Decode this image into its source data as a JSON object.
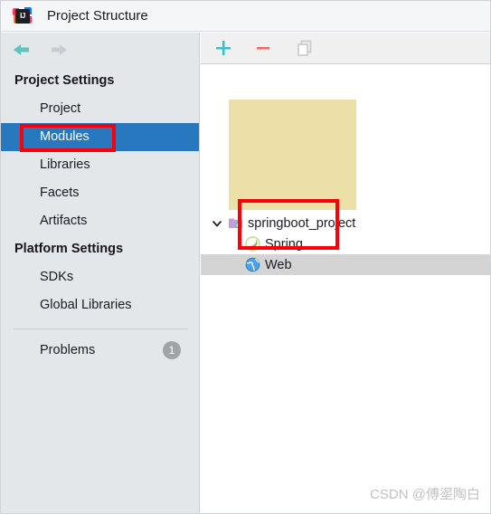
{
  "window": {
    "title": "Project Structure",
    "app_icon": "intellij-idea-icon",
    "icon_text": "IJ"
  },
  "nav": {
    "back_icon": "arrow-left-icon",
    "forward_icon": "arrow-right-icon",
    "back_enabled_color": "#5fc3c0",
    "forward_disabled_color": "#c8cdd1"
  },
  "sidebar": {
    "groups": [
      {
        "title": "Project Settings",
        "items": [
          {
            "label": "Project",
            "selected": false
          },
          {
            "label": "Modules",
            "selected": true
          },
          {
            "label": "Libraries",
            "selected": false
          },
          {
            "label": "Facets",
            "selected": false
          },
          {
            "label": "Artifacts",
            "selected": false
          }
        ]
      },
      {
        "title": "Platform Settings",
        "items": [
          {
            "label": "SDKs",
            "selected": false
          },
          {
            "label": "Global Libraries",
            "selected": false
          }
        ]
      }
    ],
    "problems": {
      "label": "Problems",
      "count": "1"
    },
    "selection_color": "#2878c0"
  },
  "toolbar": {
    "add_label": "+",
    "add_icon": "plus-icon",
    "add_color": "#3ec0c9",
    "remove_label": "−",
    "remove_icon": "minus-icon",
    "remove_color": "#ec6b64",
    "copy_icon": "copy-icon",
    "copy_color": "#c6c6c6"
  },
  "tree": {
    "rows": [
      {
        "label": "springboot_project",
        "icon": "module-folder-icon",
        "expanded": true,
        "selected": false,
        "depth": 0
      },
      {
        "label": "Spring",
        "icon": "spring-facet-icon",
        "selected": false,
        "depth": 1
      },
      {
        "label": "Web",
        "icon": "web-facet-icon",
        "selected": true,
        "depth": 1
      }
    ],
    "selected_row_color": "#d4d4d4",
    "redaction_color": "#ecdfa8"
  },
  "annotations": {
    "box_color": "#fb0008",
    "boxes": [
      {
        "name": "modules-highlight"
      },
      {
        "name": "facets-highlight"
      }
    ]
  },
  "watermark": {
    "text": "CSDN @傅埿陶白"
  }
}
